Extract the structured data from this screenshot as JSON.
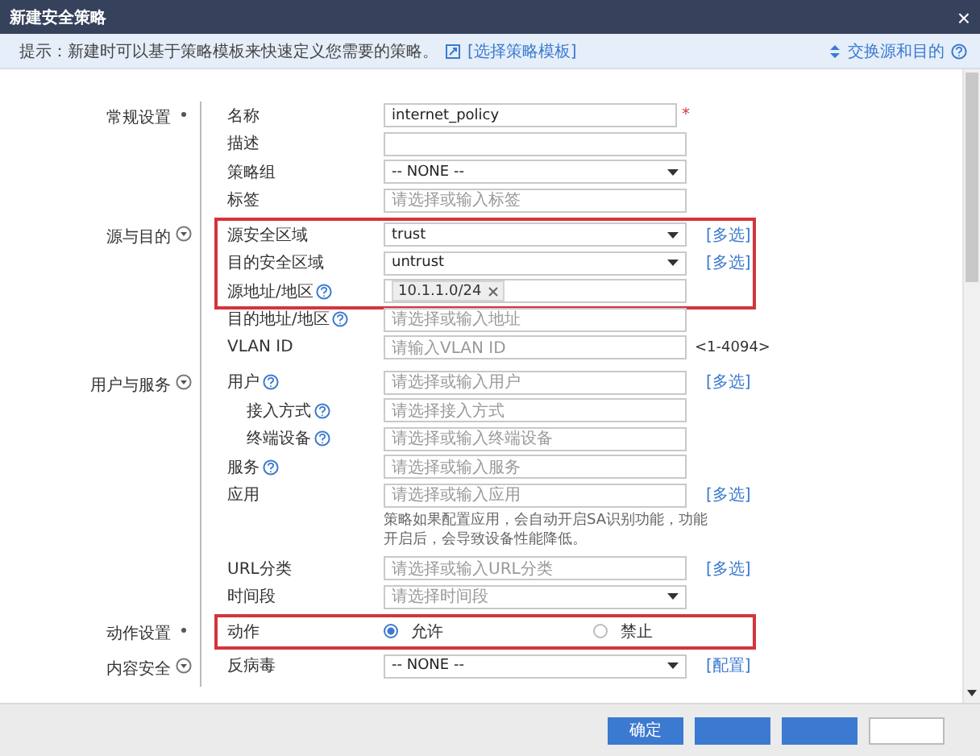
{
  "window": {
    "title": "新建安全策略",
    "close": "×"
  },
  "tip": {
    "text": "提示：新建时可以基于策略模板来快速定义您需要的策略。",
    "link": "[选择策略模板]",
    "swap": "交换源和目的"
  },
  "sections": [
    {
      "label": "常规设置",
      "collapsible": false,
      "groups": [
        {
          "fields": [
            {
              "label": "名称",
              "kind": "text",
              "value": "internet_policy",
              "required_mark": "*"
            },
            {
              "label": "描述",
              "kind": "text"
            },
            {
              "label": "策略组",
              "kind": "select",
              "value": "-- NONE --"
            },
            {
              "label": "标签",
              "kind": "text",
              "placeholder": "请选择或输入标签"
            }
          ]
        }
      ]
    },
    {
      "label": "源与目的",
      "collapsible": true,
      "groups": [
        {
          "highlighted": true,
          "fields": [
            {
              "label": "源安全区域",
              "kind": "select",
              "value": "trust",
              "link": "[多选]"
            },
            {
              "label": "目的安全区域",
              "kind": "select",
              "value": "untrust",
              "link": "[多选]"
            },
            {
              "label": "源地址/地区",
              "kind": "tags",
              "help": true,
              "tags": [
                "10.1.1.0/24"
              ]
            }
          ]
        },
        {
          "fields": [
            {
              "label": "目的地址/地区",
              "kind": "text",
              "help": true,
              "placeholder": "请选择或输入地址"
            },
            {
              "label": "VLAN ID",
              "kind": "text",
              "placeholder": "请输入VLAN ID",
              "suffix": "<1-4094>"
            }
          ]
        }
      ]
    },
    {
      "label": "用户与服务",
      "collapsible": true,
      "groups": [
        {
          "fields": [
            {
              "label": "用户",
              "kind": "text",
              "help": true,
              "placeholder": "请选择或输入用户",
              "link": "[多选]",
              "children": [
                {
                  "label": "接入方式",
                  "kind": "text",
                  "help": true,
                  "placeholder": "请选择接入方式"
                },
                {
                  "label": "终端设备",
                  "kind": "text",
                  "help": true,
                  "placeholder": "请选择或输入终端设备"
                }
              ]
            },
            {
              "label": "服务",
              "kind": "text",
              "help": true,
              "placeholder": "请选择或输入服务"
            },
            {
              "label": "应用",
              "kind": "text",
              "placeholder": "请选择或输入应用",
              "link": "[多选]",
              "note": "策略如果配置应用，会自动开启SA识别功能，功能开启后，会导致设备性能降低。"
            },
            {
              "label": "URL分类",
              "kind": "text",
              "placeholder": "请选择或输入URL分类",
              "link": "[多选]"
            },
            {
              "label": "时间段",
              "kind": "select",
              "placeholder": "请选择时间段"
            }
          ]
        }
      ]
    },
    {
      "label": "动作设置",
      "collapsible": false,
      "groups": [
        {
          "highlighted": true,
          "fields": [
            {
              "label": "动作",
              "kind": "radio",
              "options": [
                {
                  "label": "允许",
                  "selected": true
                },
                {
                  "label": "禁止",
                  "selected": false
                }
              ]
            }
          ]
        }
      ]
    },
    {
      "label": "内容安全",
      "collapsible": true,
      "groups": [
        {
          "fields": [
            {
              "label": "反病毒",
              "kind": "select",
              "value": "-- NONE --",
              "link": "[配置]"
            }
          ]
        }
      ]
    }
  ],
  "buttons": [
    {
      "label": "确定",
      "kind": "primary"
    },
    {
      "kind": "primary"
    },
    {
      "kind": "primary"
    },
    {
      "kind": "secondary"
    }
  ]
}
